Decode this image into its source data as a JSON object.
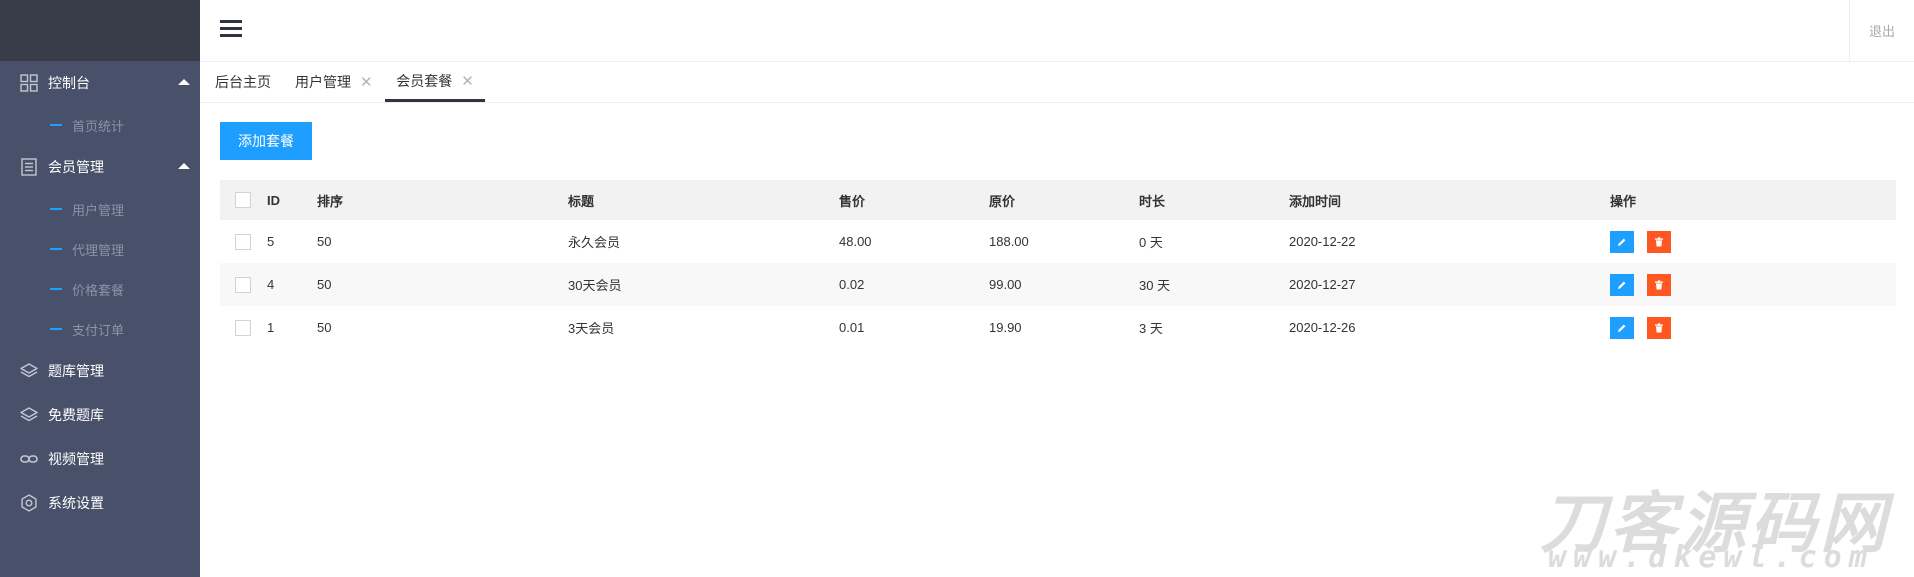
{
  "sidebar": {
    "groups": [
      {
        "label": "控制台",
        "icon": "dashboard-icon",
        "expanded": true,
        "items": [
          {
            "label": "首页统计"
          }
        ]
      },
      {
        "label": "会员管理",
        "icon": "document-icon",
        "expanded": true,
        "items": [
          {
            "label": "用户管理"
          },
          {
            "label": "代理管理"
          },
          {
            "label": "价格套餐"
          },
          {
            "label": "支付订单"
          }
        ]
      },
      {
        "label": "题库管理",
        "icon": "layers-icon"
      },
      {
        "label": "免费题库",
        "icon": "layers-icon"
      },
      {
        "label": "视频管理",
        "icon": "link-icon"
      },
      {
        "label": "系统设置",
        "icon": "gear-icon"
      }
    ]
  },
  "header": {
    "logout_label": "退出"
  },
  "tabs": [
    {
      "label": "后台主页"
    },
    {
      "label": "用户管理",
      "closable": true
    },
    {
      "label": "会员套餐",
      "closable": true,
      "active": true
    }
  ],
  "toolbar": {
    "add_label": "添加套餐"
  },
  "table": {
    "columns": [
      "ID",
      "排序",
      "标题",
      "售价",
      "原价",
      "时长",
      "添加时间",
      "操作"
    ],
    "rows": [
      {
        "id": "5",
        "sort": "50",
        "title": "永久会员",
        "price": "48.00",
        "original_price": "188.00",
        "duration": "0 天",
        "added": "2020-12-22"
      },
      {
        "id": "4",
        "sort": "50",
        "title": "30天会员",
        "price": "0.02",
        "original_price": "99.00",
        "duration": "30 天",
        "added": "2020-12-27"
      },
      {
        "id": "1",
        "sort": "50",
        "title": "3天会员",
        "price": "0.01",
        "original_price": "19.90",
        "duration": "3 天",
        "added": "2020-12-26"
      }
    ]
  },
  "watermark": {
    "text": "刀客源码网",
    "url": "www.dkewl.com"
  },
  "colors": {
    "sidebar_bg": "#48506a",
    "logo_bg": "#393d49",
    "primary": "#1e9fff",
    "danger": "#ff5722",
    "header_bg": "#f2f2f2"
  }
}
